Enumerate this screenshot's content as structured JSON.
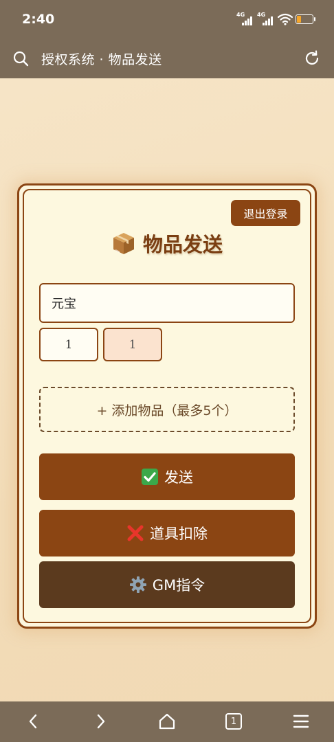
{
  "status_bar": {
    "time": "2:40",
    "network_1": "4G",
    "network_2": "4G",
    "battery_color": "#f6a62a"
  },
  "browser": {
    "title": "授权系统 · 物品发送",
    "icons": [
      "search-icon",
      "reload-icon"
    ]
  },
  "page": {
    "logout_label": "退出登录",
    "title": "物品发送",
    "title_icon": "package-icon",
    "item_name": "元宝",
    "quantity_1": "1",
    "quantity_2": "1",
    "add_item_label": "+ 添加物品（最多5个）",
    "send_label": "发送",
    "deduct_label": "道具扣除",
    "gm_label": "GM指令"
  },
  "colors": {
    "primary": "#8b4513",
    "dark": "#5b3a1e",
    "card_bg": "#fdf6de",
    "browser_bar": "#7b6b58"
  },
  "bottom_nav": {
    "tab_count": "1",
    "icons": [
      "back-icon",
      "forward-icon",
      "home-icon",
      "tabs-icon",
      "menu-icon"
    ]
  }
}
